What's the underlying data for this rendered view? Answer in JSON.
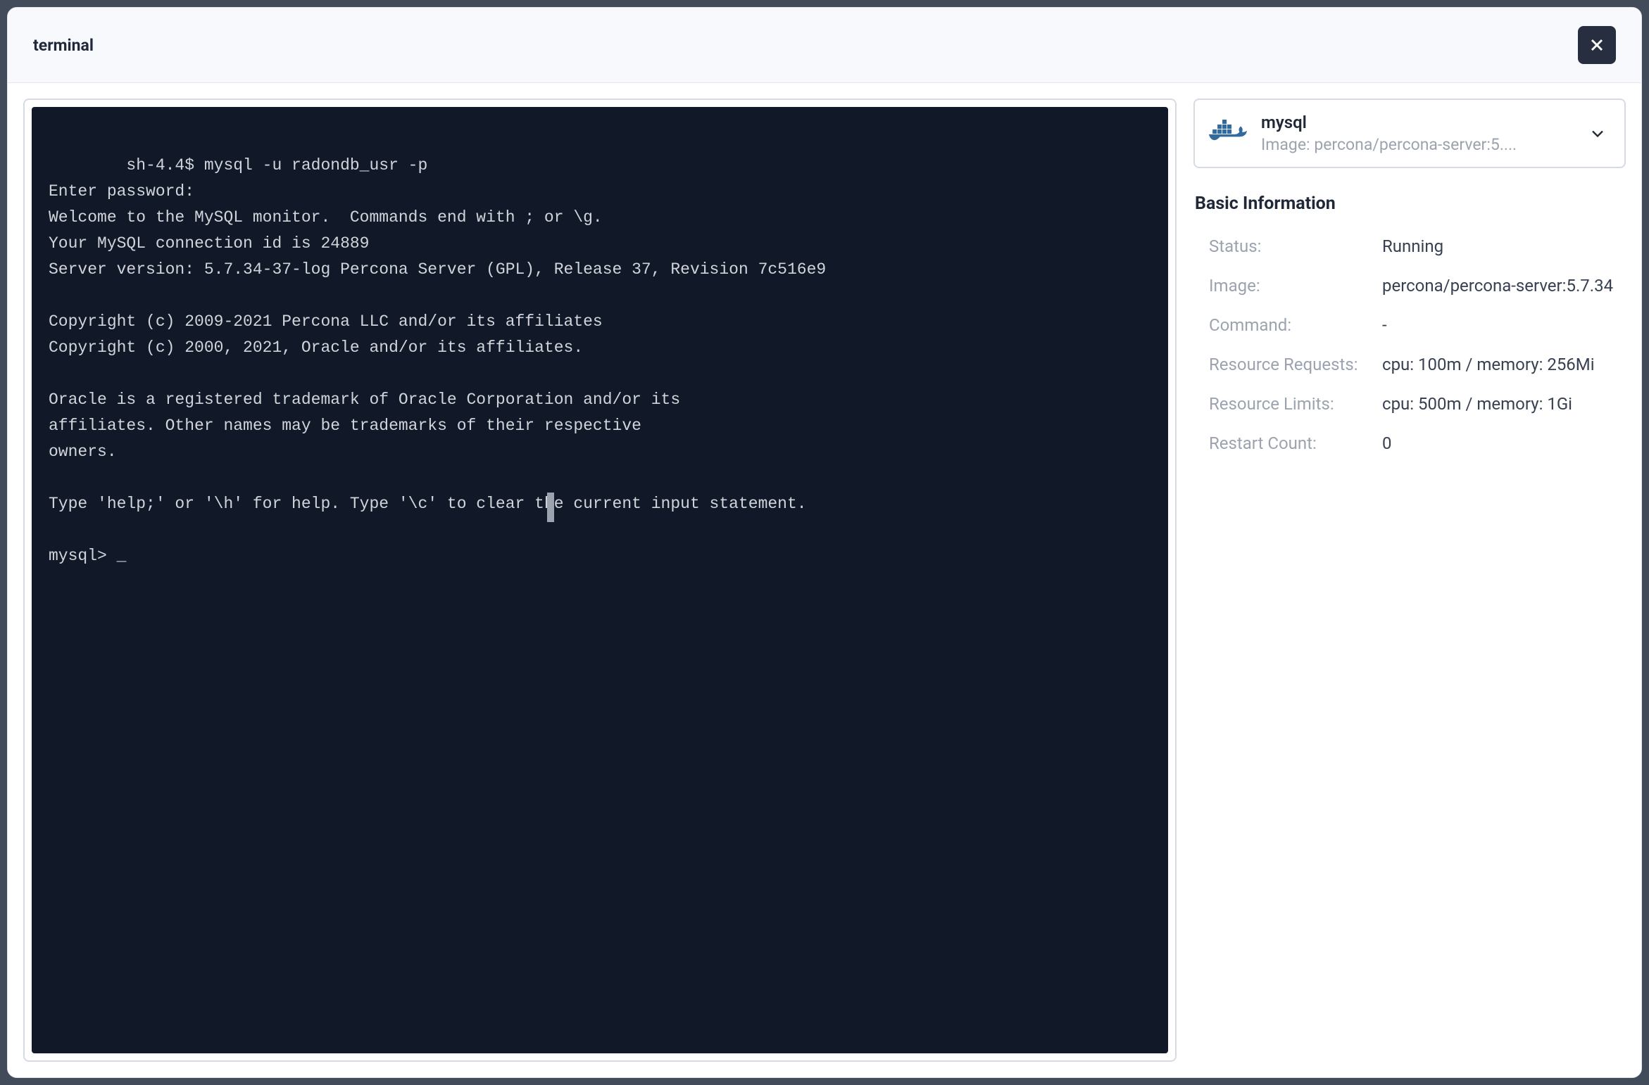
{
  "header": {
    "title": "terminal"
  },
  "terminal": {
    "content": "sh-4.4$ mysql -u radondb_usr -p\nEnter password:\nWelcome to the MySQL monitor.  Commands end with ; or \\g.\nYour MySQL connection id is 24889\nServer version: 5.7.34-37-log Percona Server (GPL), Release 37, Revision 7c516e9\n\nCopyright (c) 2009-2021 Percona LLC and/or its affiliates\nCopyright (c) 2000, 2021, Oracle and/or its affiliates.\n\nOracle is a registered trademark of Oracle Corporation and/or its\naffiliates. Other names may be trademarks of their respective\nowners.\n\nType 'help;' or '\\h' for help. Type '\\c' to clear the current input statement.\n\nmysql> _"
  },
  "container": {
    "name": "mysql",
    "image_label": "Image: percona/percona-server:5...."
  },
  "info": {
    "section_title": "Basic Information",
    "rows": [
      {
        "label": "Status:",
        "value": "Running"
      },
      {
        "label": "Image:",
        "value": "percona/percona-server:5.7.34"
      },
      {
        "label": "Command:",
        "value": "-"
      },
      {
        "label": "Resource Requests:",
        "value": "cpu: 100m / memory: 256Mi"
      },
      {
        "label": "Resource Limits:",
        "value": "cpu: 500m / memory: 1Gi"
      },
      {
        "label": "Restart Count:",
        "value": "0"
      }
    ]
  }
}
